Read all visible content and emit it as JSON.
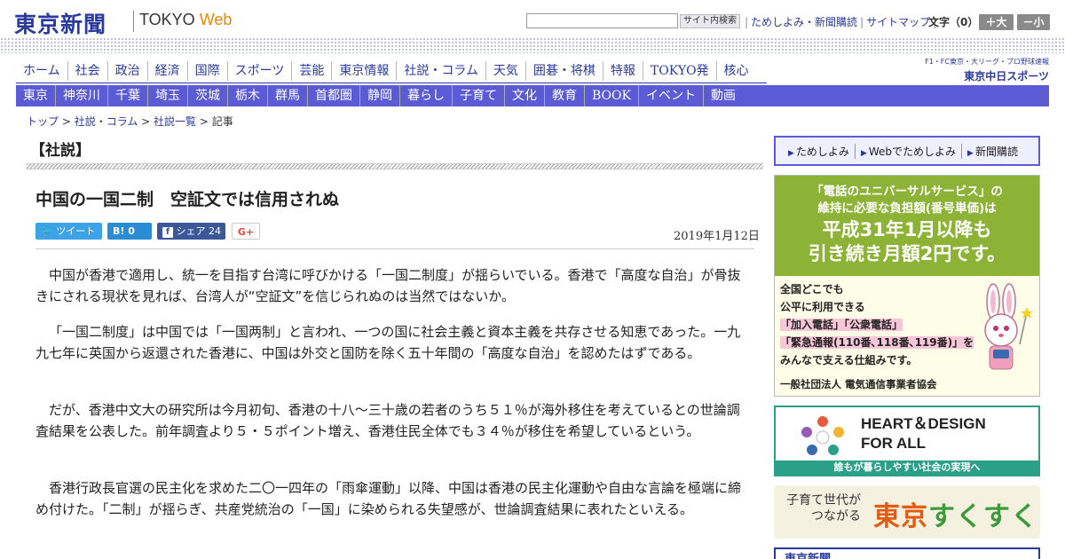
{
  "header": {
    "logo_kanji": "東京新聞",
    "logo_tokyo": "TOKYO",
    "logo_web": "Web",
    "search_placeholder": "",
    "search_button": "サイト内検索",
    "links": [
      "ためしよみ・新聞購読",
      "サイトマップ"
    ],
    "font_size_label": "文字（0）",
    "font_plus": "＋大",
    "font_minus": "－小"
  },
  "nav_primary": [
    "ホーム",
    "社会",
    "政治",
    "経済",
    "国際",
    "スポーツ",
    "芸能",
    "東京情報",
    "社説・コラム",
    "天気",
    "囲碁・将棋",
    "特報",
    "TOKYO発",
    "核心"
  ],
  "nav_secondary": [
    "東京",
    "神奈川",
    "千葉",
    "埼玉",
    "茨城",
    "栃木",
    "群馬",
    "首都圏",
    "静岡",
    "暮らし",
    "子育て",
    "文化",
    "教育",
    "BOOK",
    "イベント",
    "動画"
  ],
  "chunichi": {
    "small": "F1・FC東京・大リーグ・プロ野球速報",
    "big": "東京中日スポーツ"
  },
  "breadcrumb": [
    "トップ",
    "社説・コラム",
    "社説一覧",
    "記事"
  ],
  "article": {
    "section": "【社説】",
    "title": "中国の一国二制　空証文では信用されぬ",
    "date": "2019年1月12日",
    "share": {
      "tweet": "ツイート",
      "hatena": "0",
      "facebook_label": "シェア",
      "facebook_count": "24",
      "gplus": "G+"
    },
    "paragraphs": [
      "中国が香港で適用し、統一を目指す台湾に呼びかける「一国二制度」が揺らいでいる。香港で「高度な自治」が骨抜きにされる現状を見れば、台湾人が“空証文”を信じられぬのは当然ではないか。",
      "「一国二制度」は中国では「一国两制」と言われ、一つの国に社会主義と資本主義を共存させる知恵であった。一九九七年に英国から返還された香港に、中国は外交と国防を除く五十年間の「高度な自治」を認めたはずである。",
      "だが、香港中文大の研究所は今月初旬、香港の十八～三十歳の若者のうち５１％が海外移住を考えているとの世論調査結果を公表した。前年調査より５・５ポイント増え、香港住民全体でも３４％が移住を希望しているという。",
      "香港行政長官選の民主化を求めた二〇一四年の「雨傘運動」以降、中国は香港の民主化運動や自由な言論を極端に締め付けた。「二制」が揺らぎ、共産党統治の「一国」に染められる失望感が、世論調査結果に表れたといえる。"
    ]
  },
  "sidebar": {
    "sub_links": [
      "ためしよみ",
      "Webでためしよみ",
      "新聞購読"
    ],
    "ad1": {
      "line1": "「電話のユニバーサルサービス」の",
      "line2": "維持に必要な負担額(番号単価)は",
      "line3": "平成31年1月以降も",
      "line4": "引き続き月額2円です。",
      "body1": "全国どこでも",
      "body2": "公平に利用できる",
      "body3": "「加入電話」「公衆電話」",
      "body4": "「緊急通報(110番､118番､119番)」を",
      "body5": "みんなで支える仕組みです。",
      "foot": "一般社団法人 電気通信事業者協会"
    },
    "ad2": {
      "line1": "HEART＆DESIGN",
      "line2": "FOR ALL",
      "bar": "誰もが暮らしやすい社会の実現へ"
    },
    "ad3": {
      "small1": "子育て世代が",
      "small2": "つながる",
      "big1": "東京",
      "big2": "すくすく"
    },
    "ad4": {
      "text": "東京新聞"
    }
  },
  "colors": {
    "brand_blue": "#2a3a9e",
    "nav_purple": "#5b5bd6",
    "ad_green": "#8cb335",
    "teal": "#2aa088"
  }
}
